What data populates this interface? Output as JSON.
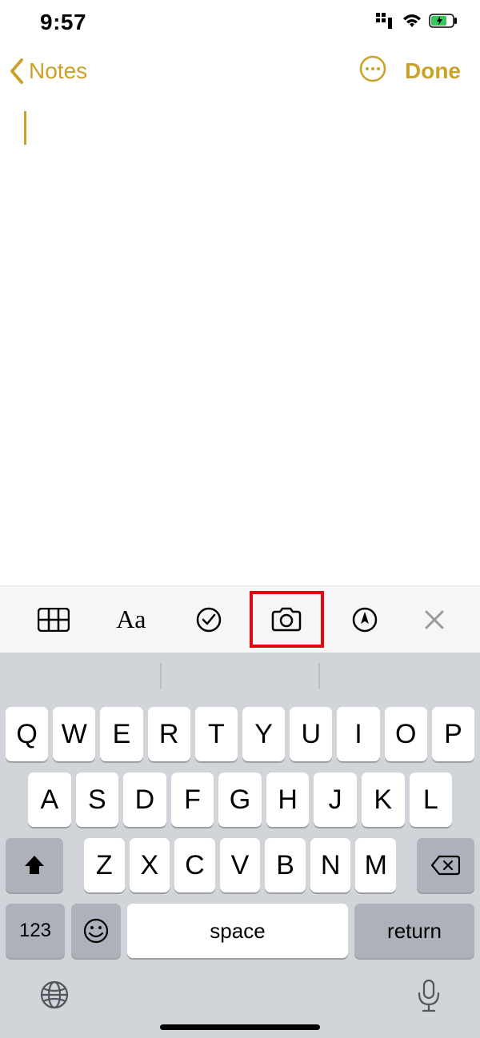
{
  "status": {
    "time": "9:57"
  },
  "nav": {
    "back_label": "Notes",
    "done_label": "Done"
  },
  "editor": {
    "content": ""
  },
  "toolbar": {
    "aa_label": "Aa"
  },
  "keyboard": {
    "row1": [
      "Q",
      "W",
      "E",
      "R",
      "T",
      "Y",
      "U",
      "I",
      "O",
      "P"
    ],
    "row2": [
      "A",
      "S",
      "D",
      "F",
      "G",
      "H",
      "J",
      "K",
      "L"
    ],
    "row3": [
      "Z",
      "X",
      "C",
      "V",
      "B",
      "N",
      "M"
    ],
    "num_label": "123",
    "space_label": "space",
    "return_label": "return"
  }
}
